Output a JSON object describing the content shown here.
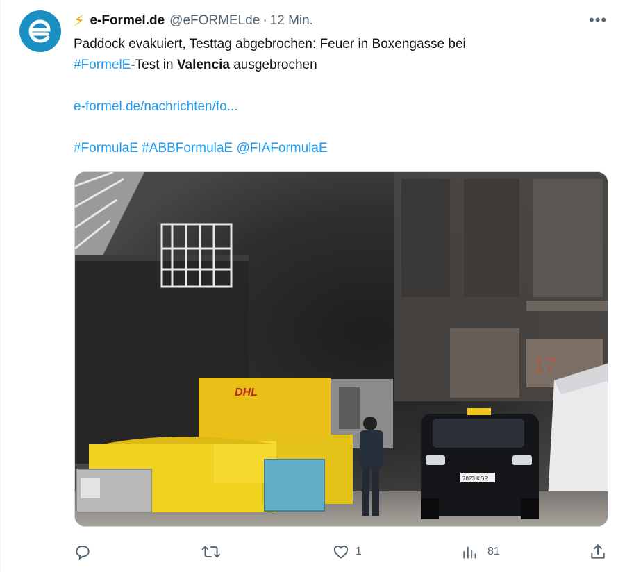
{
  "tweet": {
    "display_name": "e-Formel.de",
    "handle": "@eFORMELde",
    "separator": "·",
    "time": "12 Min.",
    "text": {
      "line1": "Paddock evakuiert, Testtag abgebrochen: Feuer in Boxengasse bei",
      "line2_hashtag": "#FormelE",
      "line2_mid": "-Test in ",
      "line2_bold": "Valencia",
      "line2_end": " ausgebrochen",
      "link": "e-formel.de/nachrichten/fo...",
      "hashtag1": "#FormulaE",
      "hashtag2": "#ABBFormulaE",
      "mention": "@FIAFormulaE"
    },
    "media": {
      "container_label": "DHL",
      "garage_number": "17",
      "plate": "7823 KGR"
    }
  },
  "actions": {
    "reply_count": "",
    "retweet_count": "",
    "like_count": "1",
    "views_count": "81"
  },
  "icons": [
    "avatar-e-logo",
    "lightning-icon",
    "more-icon",
    "reply-icon",
    "retweet-icon",
    "like-icon",
    "views-icon",
    "share-icon"
  ],
  "colors": {
    "accent": "#1d9bf0",
    "avatar": "#1a8fc2",
    "bolt": "#f4a100",
    "muted": "#536471"
  }
}
